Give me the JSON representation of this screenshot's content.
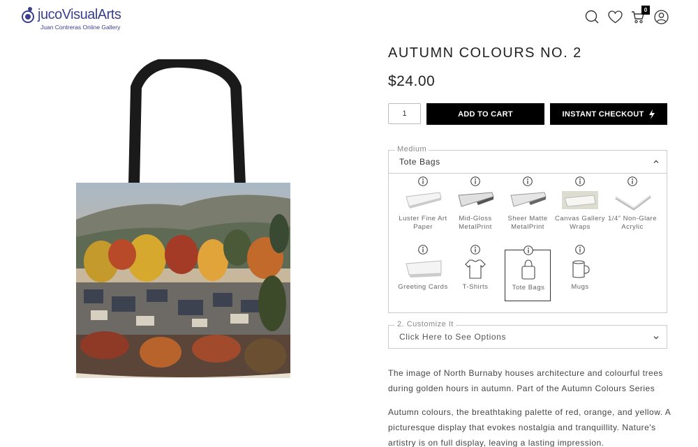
{
  "header": {
    "logo_text": "jucoVisualArts",
    "logo_sub": "Juan Contreras Online Gallery",
    "cart_count": "0",
    "icons": [
      "search-icon",
      "heart-icon",
      "cart-icon",
      "user-icon"
    ]
  },
  "product": {
    "title": "AUTUMN COLOURS NO. 2",
    "price": "$24.00",
    "quantity": "1",
    "add_to_cart_label": "ADD TO CART",
    "instant_checkout_label": "INSTANT CHECKOUT"
  },
  "medium": {
    "legend": "Medium",
    "selected": "Tote Bags",
    "options": [
      {
        "label": "Luster Fine Art Paper",
        "icon": "paper-icon"
      },
      {
        "label": "Mid-Gloss MetalPrint",
        "icon": "metal-icon"
      },
      {
        "label": "Sheer Matte MetalPrint",
        "icon": "metal-icon"
      },
      {
        "label": "Canvas Gallery Wraps",
        "icon": "canvas-icon"
      },
      {
        "label": "1/4\" Non-Glare Acrylic",
        "icon": "acrylic-icon"
      },
      {
        "label": "Greeting Cards",
        "icon": "card-icon"
      },
      {
        "label": "T-Shirts",
        "icon": "tshirt-icon"
      },
      {
        "label": "Tote Bags",
        "icon": "tote-icon"
      },
      {
        "label": "Mugs",
        "icon": "mug-icon"
      }
    ]
  },
  "customize": {
    "legend": "2. Customize It",
    "placeholder": "Click Here to See Options"
  },
  "description": {
    "p1": "The image of North Burnaby houses architecture and colourful trees during golden hours in autumn. Part of the Autumn Colours Series",
    "p2": "Autumn colours, the breathtaking palette of red, orange, and yellow. A picturesque display that evokes nostalgia and tranquillity. Nature's artistry is on full display, leaving a lasting impression."
  },
  "colors": {
    "brand": "#3a3f8f",
    "button_bg": "#000000",
    "button_text": "#ffffff"
  }
}
